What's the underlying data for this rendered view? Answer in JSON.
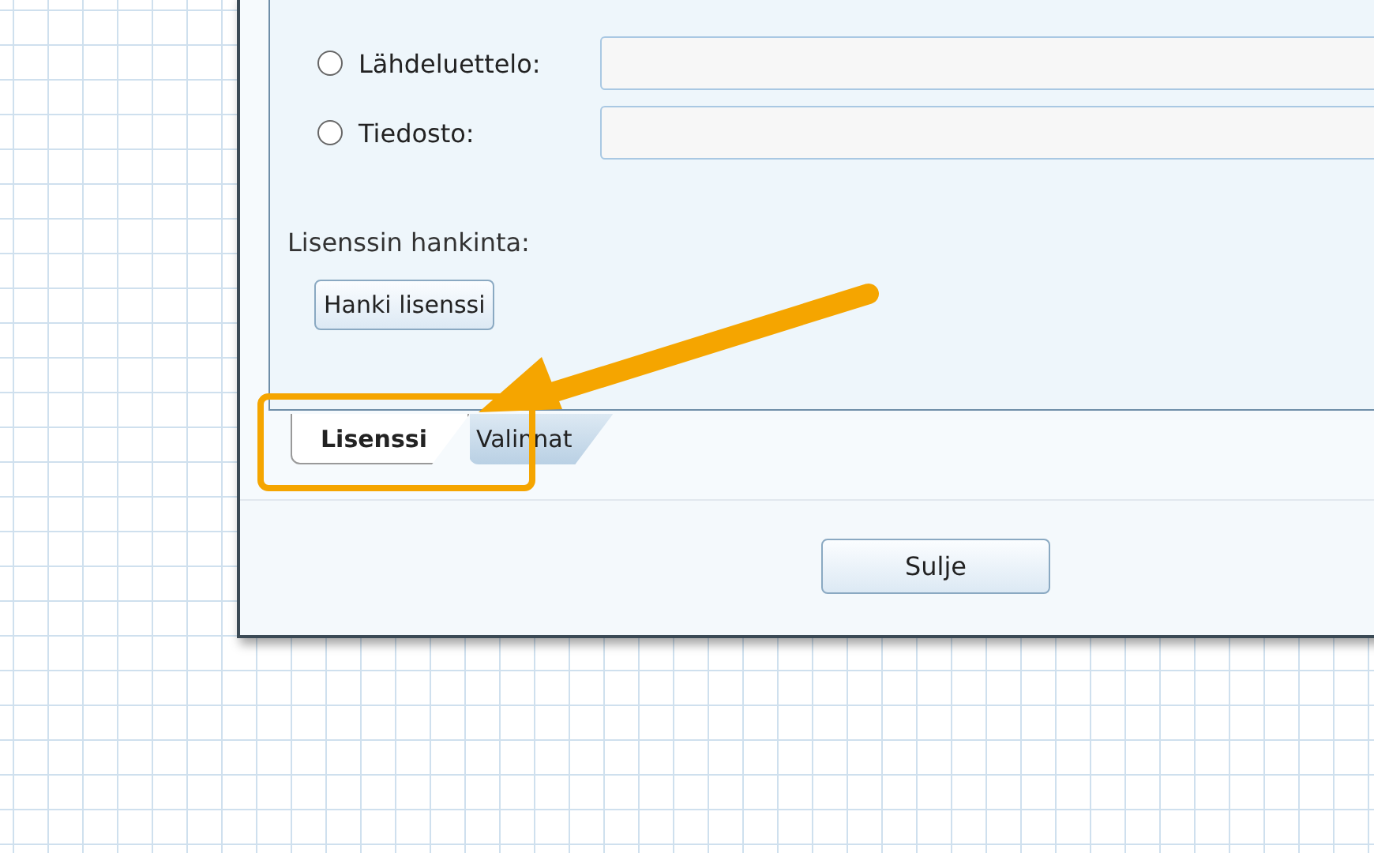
{
  "sources": [
    {
      "label": "Lähdeluettelo:",
      "selected": false
    },
    {
      "label": "Tiedosto:",
      "selected": false
    }
  ],
  "license": {
    "heading": "Lisenssin hankinta:",
    "button": "Hanki lisenssi"
  },
  "tabs": [
    {
      "label": "Lisenssi",
      "selected": true
    },
    {
      "label": "Valinnat",
      "selected": false
    }
  ],
  "buttons": [
    "Sulje"
  ]
}
